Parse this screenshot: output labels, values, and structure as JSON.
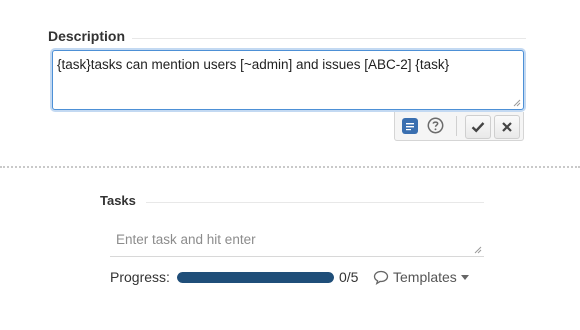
{
  "description": {
    "heading": "Description",
    "text": "{task}tasks can mention users [~admin] and issues [ABC-2] {task}",
    "toolbar": {
      "format_icon": "wiki-format-icon",
      "help_icon": "question-circle-icon",
      "confirm_icon": "checkmark-icon",
      "cancel_icon": "close-icon"
    }
  },
  "tasks": {
    "heading": "Tasks",
    "input_placeholder": "Enter task and hit enter",
    "progress_label": "Progress:",
    "progress_fraction": 1.0,
    "progress_count": "0/5",
    "templates_label": "Templates",
    "templates_icon": "speech-bubble-icon"
  },
  "colors": {
    "progress_fill": "#1f4e79",
    "focus_border": "#4d90d6",
    "format_button": "#3a6fb0"
  }
}
